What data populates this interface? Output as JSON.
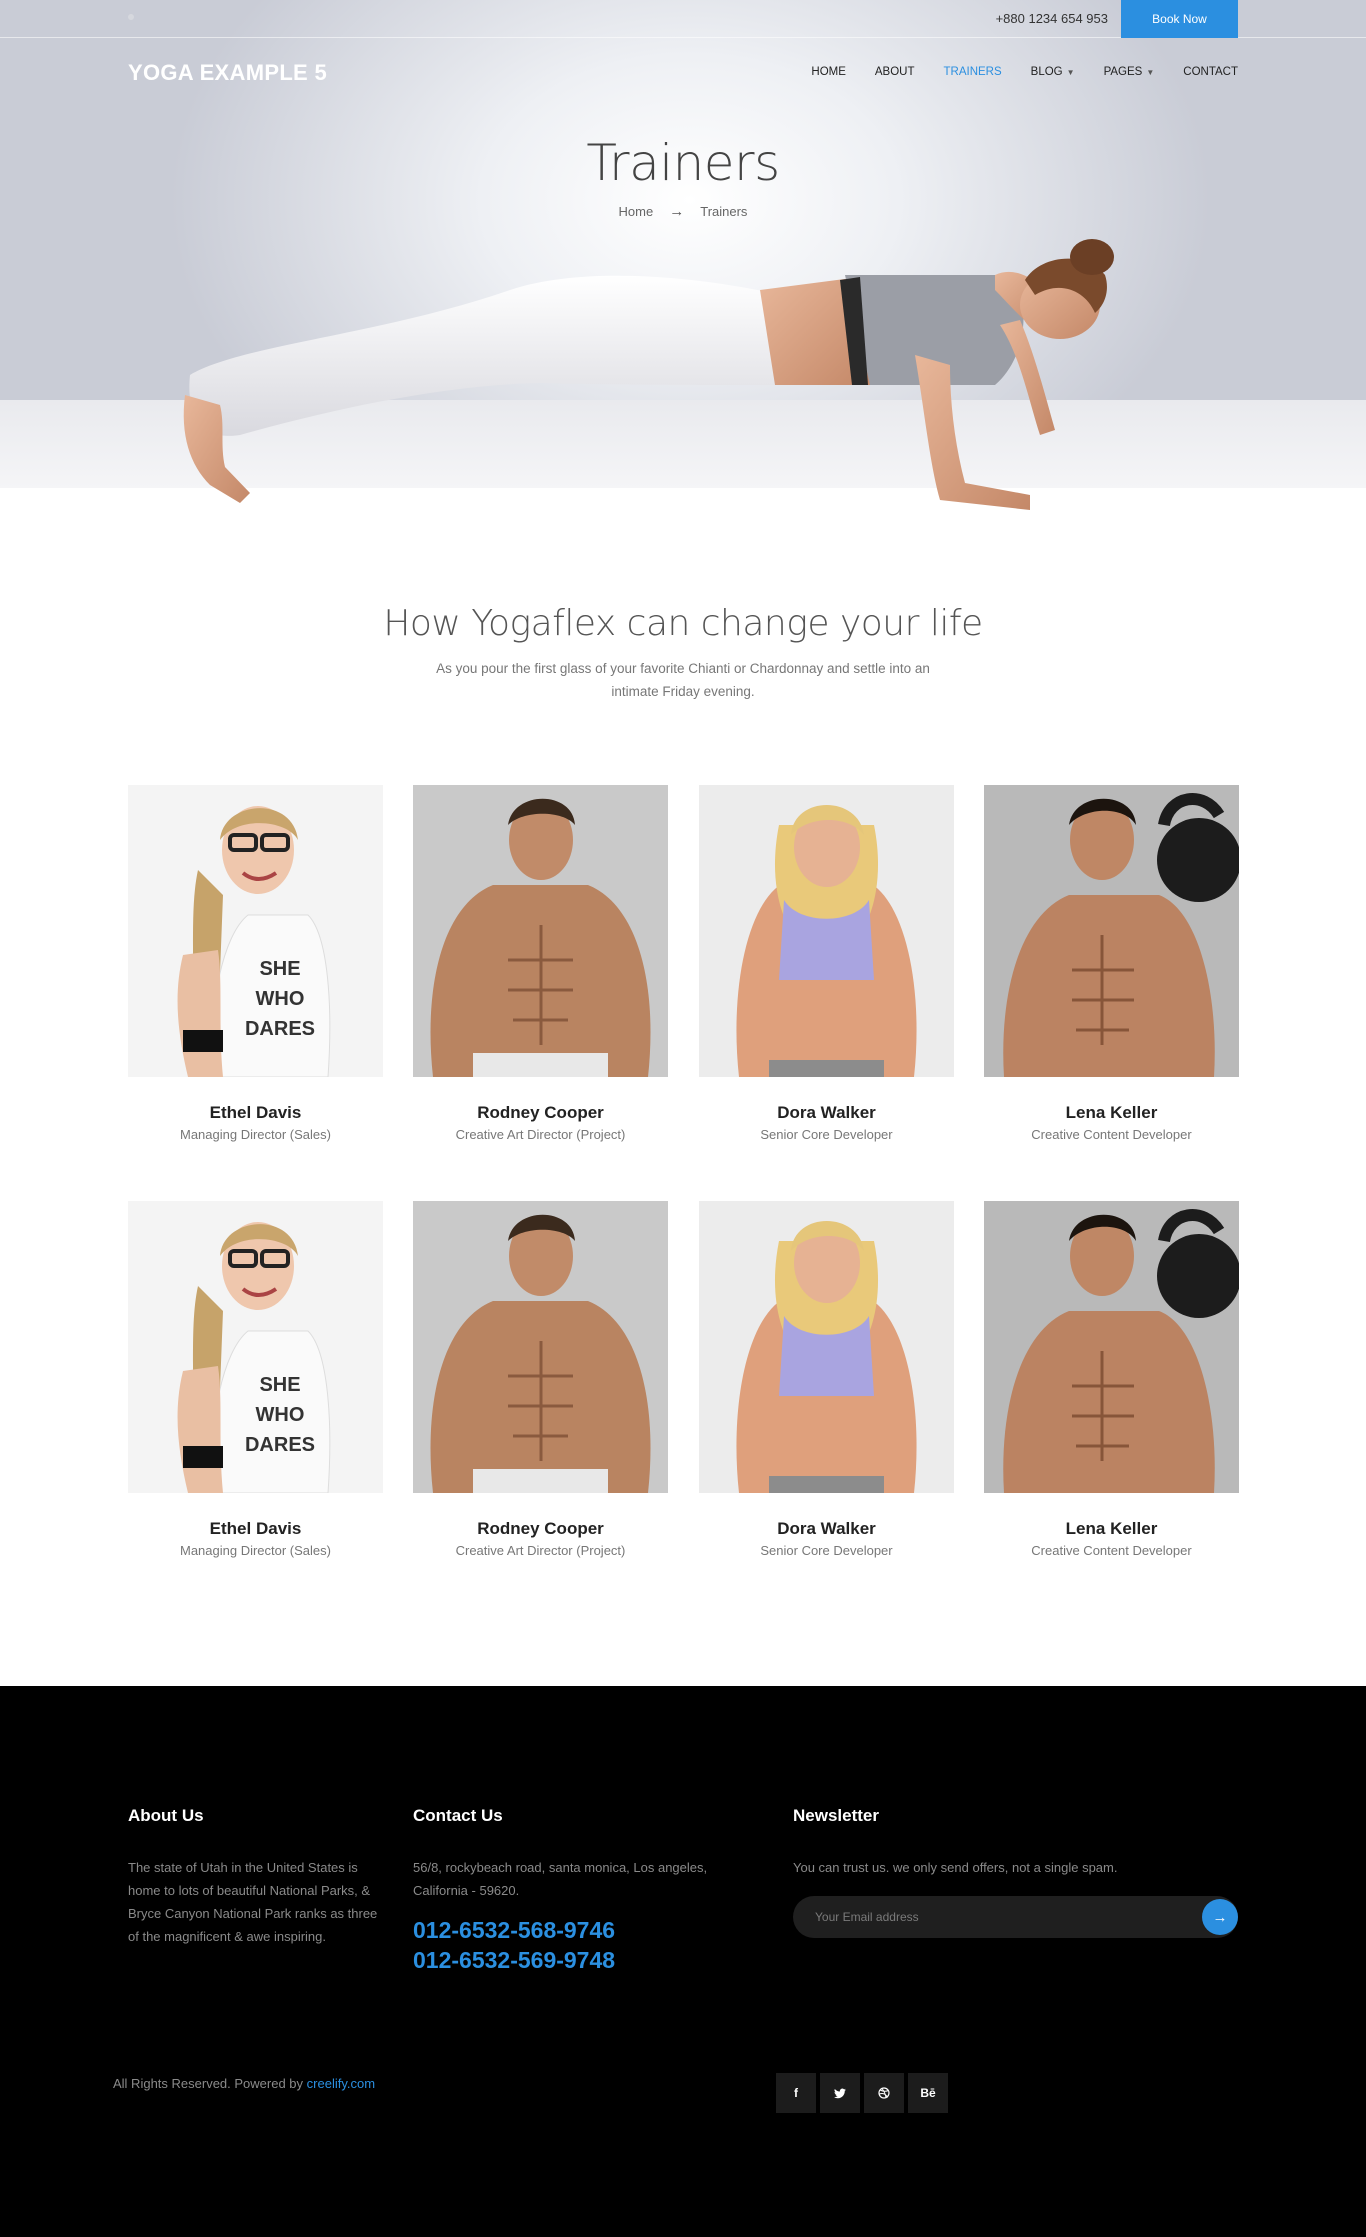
{
  "topbar": {
    "phone": "+880 1234 654 953",
    "book_label": "Book Now"
  },
  "header": {
    "logo": "YOGA EXAMPLE 5",
    "nav": [
      {
        "label": "HOME",
        "active": false,
        "dropdown": false
      },
      {
        "label": "ABOUT",
        "active": false,
        "dropdown": false
      },
      {
        "label": "TRAINERS",
        "active": true,
        "dropdown": false
      },
      {
        "label": "BLOG",
        "active": false,
        "dropdown": true
      },
      {
        "label": "PAGES",
        "active": false,
        "dropdown": true
      },
      {
        "label": "CONTACT",
        "active": false,
        "dropdown": false
      }
    ]
  },
  "hero": {
    "title": "Trainers",
    "breadcrumb_home": "Home",
    "breadcrumb_current": "Trainers"
  },
  "intro": {
    "title": "How Yogaflex can change your life",
    "text": "As you pour the first glass of your favorite Chianti or Chardonnay and settle into an intimate Friday evening."
  },
  "trainers": [
    {
      "name": "Ethel Davis",
      "role": "Managing Director (Sales)"
    },
    {
      "name": "Rodney Cooper",
      "role": "Creative Art Director (Project)"
    },
    {
      "name": "Dora Walker",
      "role": "Senior Core Developer"
    },
    {
      "name": "Lena Keller",
      "role": "Creative Content Developer"
    },
    {
      "name": "Ethel Davis",
      "role": "Managing Director (Sales)"
    },
    {
      "name": "Rodney Cooper",
      "role": "Creative Art Director (Project)"
    },
    {
      "name": "Dora Walker",
      "role": "Senior Core Developer"
    },
    {
      "name": "Lena Keller",
      "role": "Creative Content Developer"
    }
  ],
  "shirt_text": [
    "SHE",
    "WHO",
    "DARES"
  ],
  "footer": {
    "about_title": "About Us",
    "about_text": "The state of Utah in the United States is home to lots of beautiful National Parks, & Bryce Canyon National Park ranks as three of the magnificent & awe inspiring.",
    "contact_title": "Contact Us",
    "contact_address": "56/8, rockybeach road, santa monica, Los angeles, California - 59620.",
    "phone_1": "012-6532-568-9746",
    "phone_2": "012-6532-569-9748",
    "newsletter_title": "Newsletter",
    "newsletter_text": "You can trust us. we only send offers, not a single spam.",
    "newsletter_placeholder": "Your Email address",
    "copyright_prefix": "All Rights Reserved. Powered by",
    "copyright_link": "creelify.com",
    "socials": [
      "f",
      "t",
      "d",
      "Bē"
    ]
  },
  "colors": {
    "accent": "#2b8fe0",
    "footer_bg": "#000000"
  }
}
